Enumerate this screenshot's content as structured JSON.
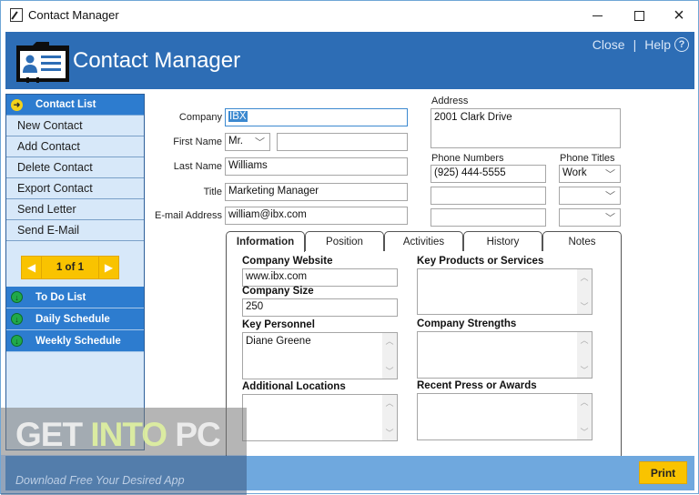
{
  "window": {
    "title": "Contact Manager",
    "controls": {
      "minimize": "minimize",
      "maximize": "maximize",
      "close": "×"
    }
  },
  "header": {
    "app_title": "Contact Manager",
    "close_link": "Close",
    "separator": "|",
    "help_link": "Help",
    "help_icon": "?"
  },
  "sidebar": {
    "contact_list_label": "Contact List",
    "items": [
      {
        "label": "New Contact"
      },
      {
        "label": "Add Contact"
      },
      {
        "label": "Delete Contact"
      },
      {
        "label": "Export Contact"
      },
      {
        "label": "Send Letter"
      },
      {
        "label": "Send E-Mail"
      }
    ],
    "pager": {
      "prev": "◀",
      "text": "1 of 1",
      "next": "▶"
    },
    "sections": [
      {
        "label": "To Do List"
      },
      {
        "label": "Daily Schedule"
      },
      {
        "label": "Weekly Schedule"
      }
    ]
  },
  "form": {
    "company": {
      "label": "Company",
      "value": "IBX"
    },
    "first_name": {
      "label": "First Name",
      "salutation": "Mr.",
      "value": ""
    },
    "last_name": {
      "label": "Last Name",
      "value": "Williams"
    },
    "title": {
      "label": "Title",
      "value": "Marketing Manager"
    },
    "email": {
      "label": "E-mail Address",
      "value": "william@ibx.com"
    },
    "address": {
      "label": "Address",
      "value": "2001 Clark Drive"
    },
    "phone_numbers": {
      "label": "Phone Numbers",
      "values": [
        "(925) 444-5555",
        "",
        ""
      ]
    },
    "phone_titles": {
      "label": "Phone Titles",
      "values": [
        "Work",
        "",
        ""
      ]
    }
  },
  "tabs": [
    {
      "label": "Information",
      "active": true
    },
    {
      "label": "Position",
      "active": false
    },
    {
      "label": "Activities",
      "active": false
    },
    {
      "label": "History",
      "active": false
    },
    {
      "label": "Notes",
      "active": false
    }
  ],
  "information": {
    "company_website": {
      "label": "Company Website",
      "value": "www.ibx.com"
    },
    "company_size": {
      "label": "Company Size",
      "value": "250"
    },
    "key_personnel": {
      "label": "Key Personnel",
      "value": "Diane Greene"
    },
    "additional_locations": {
      "label": "Additional Locations",
      "value": ""
    },
    "key_products": {
      "label": "Key Products or Services",
      "value": ""
    },
    "company_strengths": {
      "label": "Company Strengths",
      "value": ""
    },
    "recent_press": {
      "label": "Recent Press or Awards",
      "value": ""
    }
  },
  "footer": {
    "print_label": "Print"
  },
  "watermark": {
    "part1": "GET ",
    "part2": "INTO",
    "part3": " PC",
    "tagline": "Download Free Your Desired App"
  },
  "colors": {
    "header_blue": "#2d6db5",
    "sidebar_bg": "#d7e8f9",
    "accent_yellow": "#f9c300",
    "footer_blue": "#6fa8de"
  }
}
